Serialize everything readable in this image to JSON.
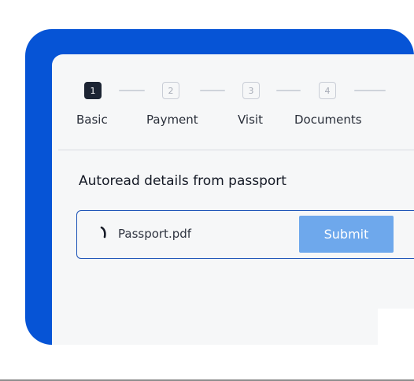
{
  "steps": [
    {
      "number": "1",
      "label": "Basic",
      "active": true
    },
    {
      "number": "2",
      "label": "Payment",
      "active": false
    },
    {
      "number": "3",
      "label": "Visit",
      "active": false
    },
    {
      "number": "4",
      "label": "Documents",
      "active": false
    }
  ],
  "upload": {
    "title": "Autoread details from passport",
    "file_name": "Passport.pdf",
    "submit_label": "Submit"
  },
  "colors": {
    "brand_blue": "#0654d6",
    "submit_disabled": "#6ea8ec",
    "active_step": "#1c2433"
  },
  "icons": {
    "loading": "spinner-icon"
  }
}
